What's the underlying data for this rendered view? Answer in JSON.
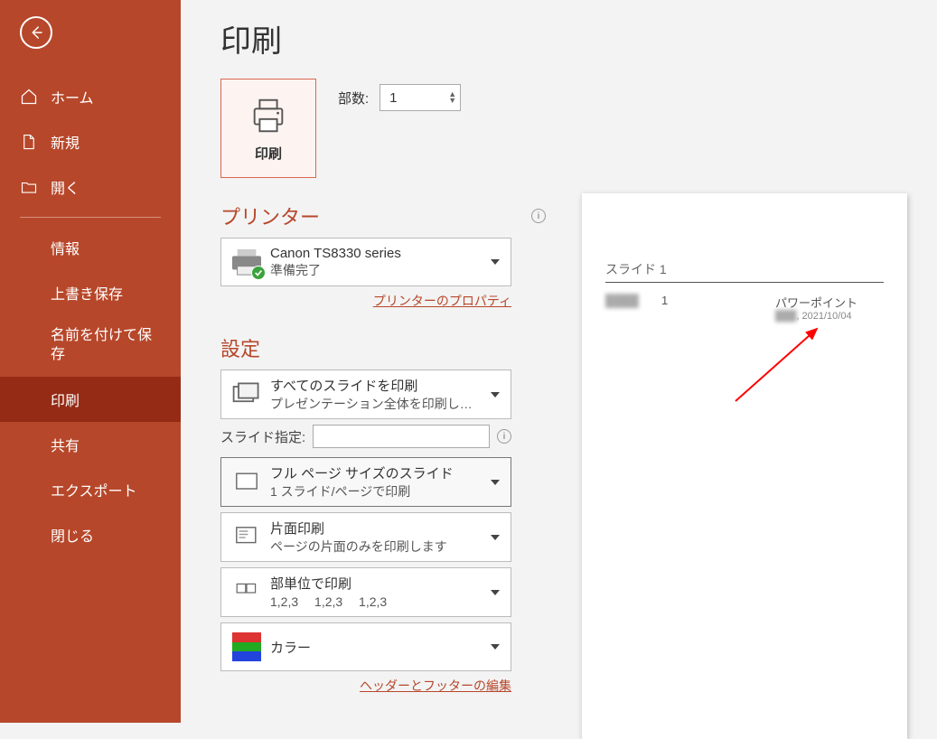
{
  "sidebar": {
    "items": [
      {
        "label": "ホーム"
      },
      {
        "label": "新規"
      },
      {
        "label": "開く"
      },
      {
        "label": "情報"
      },
      {
        "label": "上書き保存"
      },
      {
        "label": "名前を付けて保存"
      },
      {
        "label": "印刷"
      },
      {
        "label": "共有"
      },
      {
        "label": "エクスポート"
      },
      {
        "label": "閉じる"
      }
    ]
  },
  "page": {
    "title": "印刷",
    "copies_label": "部数:",
    "copies_value": "1",
    "print_button": "印刷"
  },
  "printer": {
    "heading": "プリンター",
    "name": "Canon TS8330 series",
    "status": "準備完了",
    "properties_link": "プリンターのプロパティ"
  },
  "settings": {
    "heading": "設定",
    "slides_label": "スライド指定:",
    "options": {
      "scope": {
        "line1": "すべてのスライドを印刷",
        "line2": "プレゼンテーション全体を印刷し…"
      },
      "layout": {
        "line1": "フル ページ サイズのスライド",
        "line2": "1 スライド/ページで印刷"
      },
      "sided": {
        "line1": "片面印刷",
        "line2": "ページの片面のみを印刷します"
      },
      "collate": {
        "line1": "部単位で印刷",
        "line2": "1,2,3　 1,2,3　 1,2,3"
      },
      "color": {
        "line1": "カラー",
        "line2": ""
      }
    },
    "footer_link": "ヘッダーとフッターの編集"
  },
  "preview": {
    "slide_label": "スライド 1",
    "row_num": "1",
    "row_text": "パワーポイント",
    "row_date": ", 2021/10/04"
  }
}
